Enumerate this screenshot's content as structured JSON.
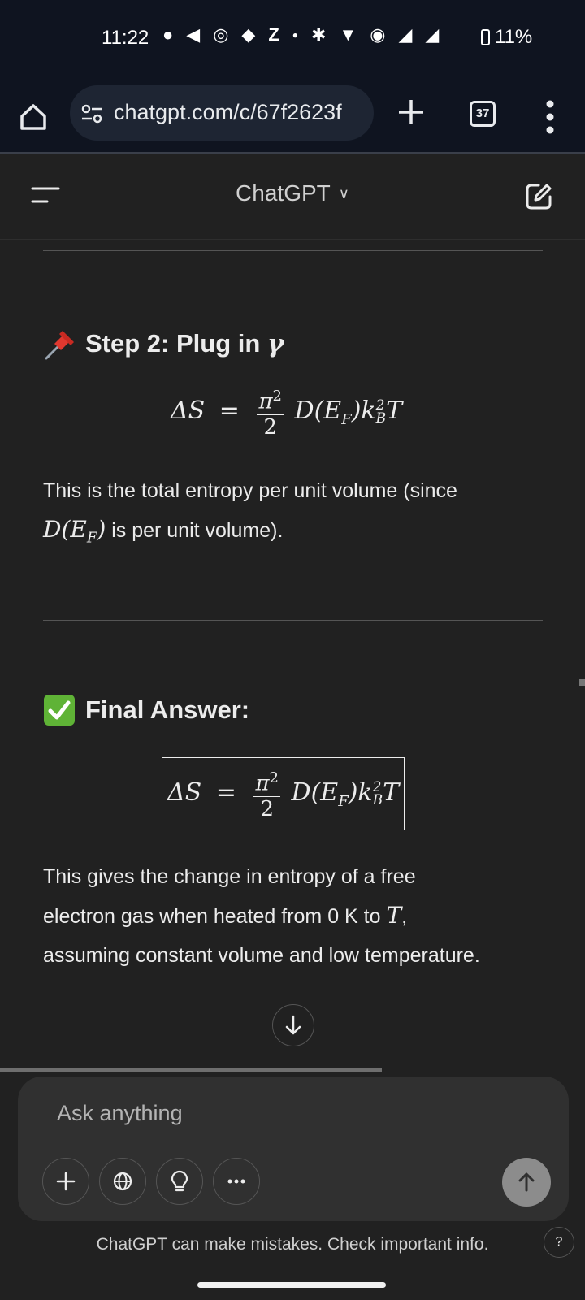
{
  "status_bar": {
    "time": "11:22",
    "battery": "11%",
    "icons": [
      "chat-bubble-icon",
      "send-icon",
      "instagram-icon",
      "location-icon",
      "z-icon",
      "dot-icon",
      "bluetooth-icon",
      "wifi-icon",
      "hotspot-icon",
      "signal-hd-icon",
      "signal-hd-icon",
      "battery-icon"
    ]
  },
  "browser": {
    "url": "chatgpt.com/c/67f2623f",
    "tab_count": "37"
  },
  "header": {
    "title": "ChatGPT"
  },
  "content": {
    "step2_heading_text": "Step 2: Plug in",
    "step2_heading_symbol": "γ",
    "step2_para_part1": "This is the total entropy per unit volume (since",
    "step2_para_math": "D(E",
    "step2_para_math_sub": "F",
    "step2_para_math_close": ")",
    "step2_para_part2": " is per unit volume).",
    "final_heading": "Final Answer:",
    "final_para_part1": "This gives the change in entropy of a free",
    "final_para_part2": "electron gas when heated from 0 K to ",
    "final_para_T": "T",
    "final_para_part3": ",",
    "final_para_part4": "assuming constant volume and low temperature."
  },
  "equation": {
    "lhs": "ΔS",
    "eq": "=",
    "num": "π",
    "num_sup": "2",
    "den": "2",
    "rhs_D": "D(E",
    "rhs_F": "F",
    "rhs_close": ")k",
    "rhs_ksup": "2",
    "rhs_ksub": "B",
    "rhs_T": "T"
  },
  "composer": {
    "placeholder": "Ask anything"
  },
  "footer": {
    "disclaimer": "ChatGPT can make mistakes. Check important info.",
    "help": "?"
  },
  "colors": {
    "background": "#212121",
    "status_bg": "#0f1420",
    "composer_bg": "#303030",
    "send_button": "#8c8c8c"
  }
}
